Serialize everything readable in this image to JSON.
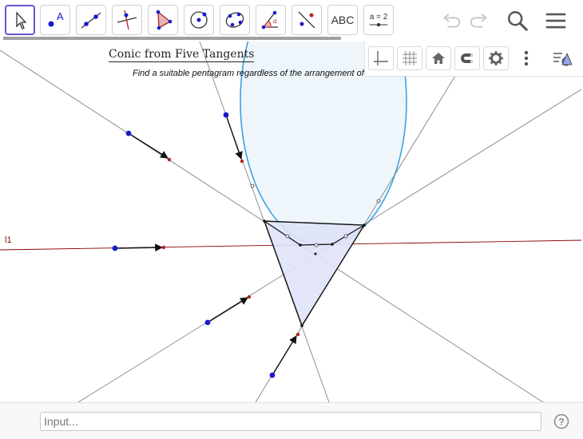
{
  "toolbar": {
    "tools": [
      {
        "id": "move",
        "icon": "move-arrow-icon",
        "active": true
      },
      {
        "id": "point",
        "icon": "point-icon",
        "label": "A"
      },
      {
        "id": "line",
        "icon": "line-icon"
      },
      {
        "id": "perpendicular",
        "icon": "perpendicular-line-icon"
      },
      {
        "id": "polygon",
        "icon": "polygon-icon"
      },
      {
        "id": "circle",
        "icon": "circle-center-point-icon"
      },
      {
        "id": "conic",
        "icon": "conic-five-points-icon"
      },
      {
        "id": "angle",
        "icon": "angle-icon",
        "label": "α"
      },
      {
        "id": "reflect",
        "icon": "reflect-line-icon"
      },
      {
        "id": "text",
        "icon": "text-icon",
        "label": "ABC"
      },
      {
        "id": "slider",
        "icon": "slider-icon",
        "label": "a = 2"
      }
    ],
    "right": [
      "undo-icon",
      "redo-icon",
      "search-icon",
      "menu-icon"
    ]
  },
  "stylebar": {
    "buttons": [
      "axes-icon",
      "grid-icon",
      "home-icon",
      "magnet-icon",
      "gear-icon",
      "more-vert-icon",
      "toggle-stylebar-icon"
    ]
  },
  "canvas": {
    "title": "Conic from Five Tangents",
    "subtitle": "Find a suitable pentagram regardless of the arrangement of lines.",
    "line_label": "l1"
  },
  "input": {
    "placeholder": "Input..."
  },
  "colors": {
    "accent": "#6557d2",
    "conic_stroke": "#3aa0e0",
    "conic_fill": "#eef6fc",
    "polygon_fill": "#dfe3f7",
    "point_blue": "#1a1ad0",
    "point_red": "#b22222",
    "line_dark_red": "#8b0000"
  }
}
